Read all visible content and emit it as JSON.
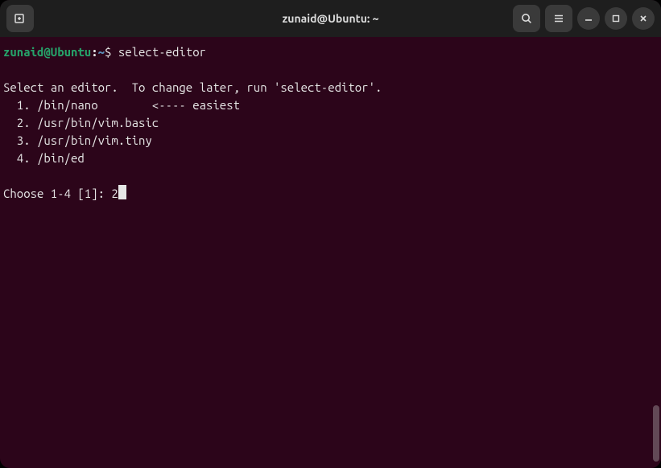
{
  "titlebar": {
    "title": "zunaid@Ubuntu: ~"
  },
  "terminal": {
    "prompt_user_host": "zunaid@Ubuntu",
    "prompt_path": "~",
    "prompt_symbol": "$",
    "command": "select-editor",
    "output_line1": "Select an editor.  To change later, run 'select-editor'.",
    "editors": [
      "  1. /bin/nano        <---- easiest",
      "  2. /usr/bin/vim.basic",
      "  3. /usr/bin/vim.tiny",
      "  4. /bin/ed"
    ],
    "choose_prompt": "Choose 1-4 [1]: ",
    "user_input": "2"
  }
}
